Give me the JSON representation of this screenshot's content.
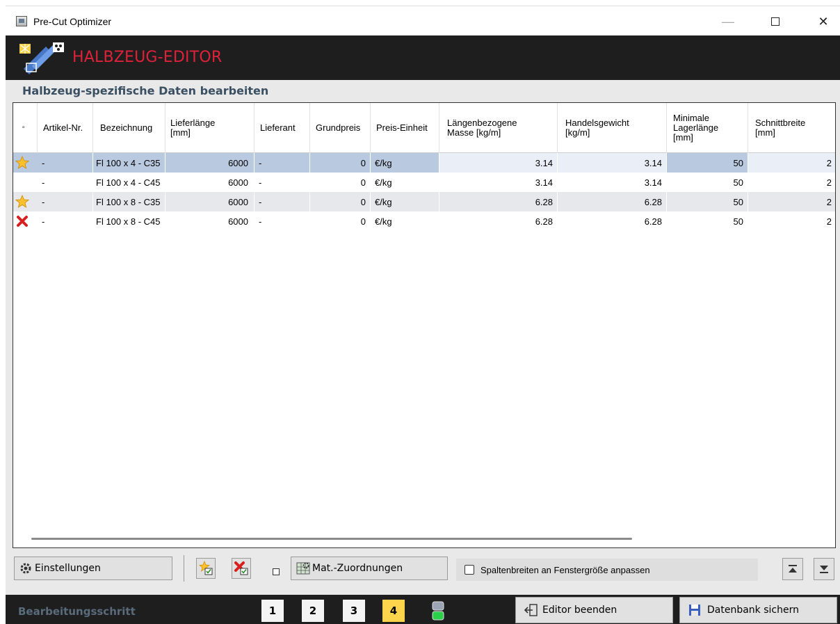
{
  "window": {
    "title": "Pre-Cut Optimizer",
    "minimize": "—",
    "close": "✕"
  },
  "header": {
    "title": "HALBZEUG-EDITOR"
  },
  "section": {
    "title": "Halbzeug-spezifische Daten bearbeiten"
  },
  "grid": {
    "columns": [
      {
        "label": "▫"
      },
      {
        "label": "Artikel-Nr."
      },
      {
        "label": "Bezeichnung"
      },
      {
        "label": "Lieferlänge\n[mm]"
      },
      {
        "label": "Lieferant"
      },
      {
        "label": "Grundpreis"
      },
      {
        "label": "Preis-Einheit"
      },
      {
        "label": "Längenbezogene\nMasse [kg/m]"
      },
      {
        "label": "Handelsgewicht\n[kg/m]"
      },
      {
        "label": "Minimale\nLagerlänge\n[mm]"
      },
      {
        "label": "Schnittbreite\n[mm]"
      }
    ],
    "rows": [
      {
        "icon": "star-icon",
        "artikel": "-",
        "bezeichnung": "Fl 100 x 4 - C35",
        "lieferlaenge": "6000",
        "lieferant": "-",
        "grundpreis": "0",
        "einheit": "€/kg",
        "masse": "3.14",
        "handelsgewicht": "3.14",
        "lagerlaenge": "50",
        "schnittbreite": "2"
      },
      {
        "icon": "",
        "artikel": "-",
        "bezeichnung": "Fl 100 x 4 - C45",
        "lieferlaenge": "6000",
        "lieferant": "-",
        "grundpreis": "0",
        "einheit": "€/kg",
        "masse": "3.14",
        "handelsgewicht": "3.14",
        "lagerlaenge": "50",
        "schnittbreite": "2"
      },
      {
        "icon": "star-icon",
        "artikel": "-",
        "bezeichnung": "Fl 100 x 8 - C35",
        "lieferlaenge": "6000",
        "lieferant": "-",
        "grundpreis": "0",
        "einheit": "€/kg",
        "masse": "6.28",
        "handelsgewicht": "6.28",
        "lagerlaenge": "50",
        "schnittbreite": "2"
      },
      {
        "icon": "delete-cross-icon",
        "artikel": "-",
        "bezeichnung": "Fl 100 x 8 - C45",
        "lieferlaenge": "6000",
        "lieferant": "-",
        "grundpreis": "0",
        "einheit": "€/kg",
        "masse": "6.28",
        "handelsgewicht": "6.28",
        "lagerlaenge": "50",
        "schnittbreite": "2"
      }
    ]
  },
  "toolbar": {
    "settings_label": "Einstellungen",
    "mat_label": "Mat.-Zuordnungen",
    "fit_columns_label": "Spaltenbreiten an Fenstergröße anpassen"
  },
  "bottom": {
    "step_label": "Bearbeitungsschritt",
    "steps": [
      "1",
      "2",
      "3",
      "4"
    ],
    "active_step": "4",
    "exit_label": "Editor beenden",
    "save_label": "Datenbank sichern"
  },
  "colors": {
    "header_bg": "#1e1e1e",
    "title_red": "#e0213a",
    "selected_row": "#b8c9e0",
    "active_step": "#ffd44d"
  }
}
